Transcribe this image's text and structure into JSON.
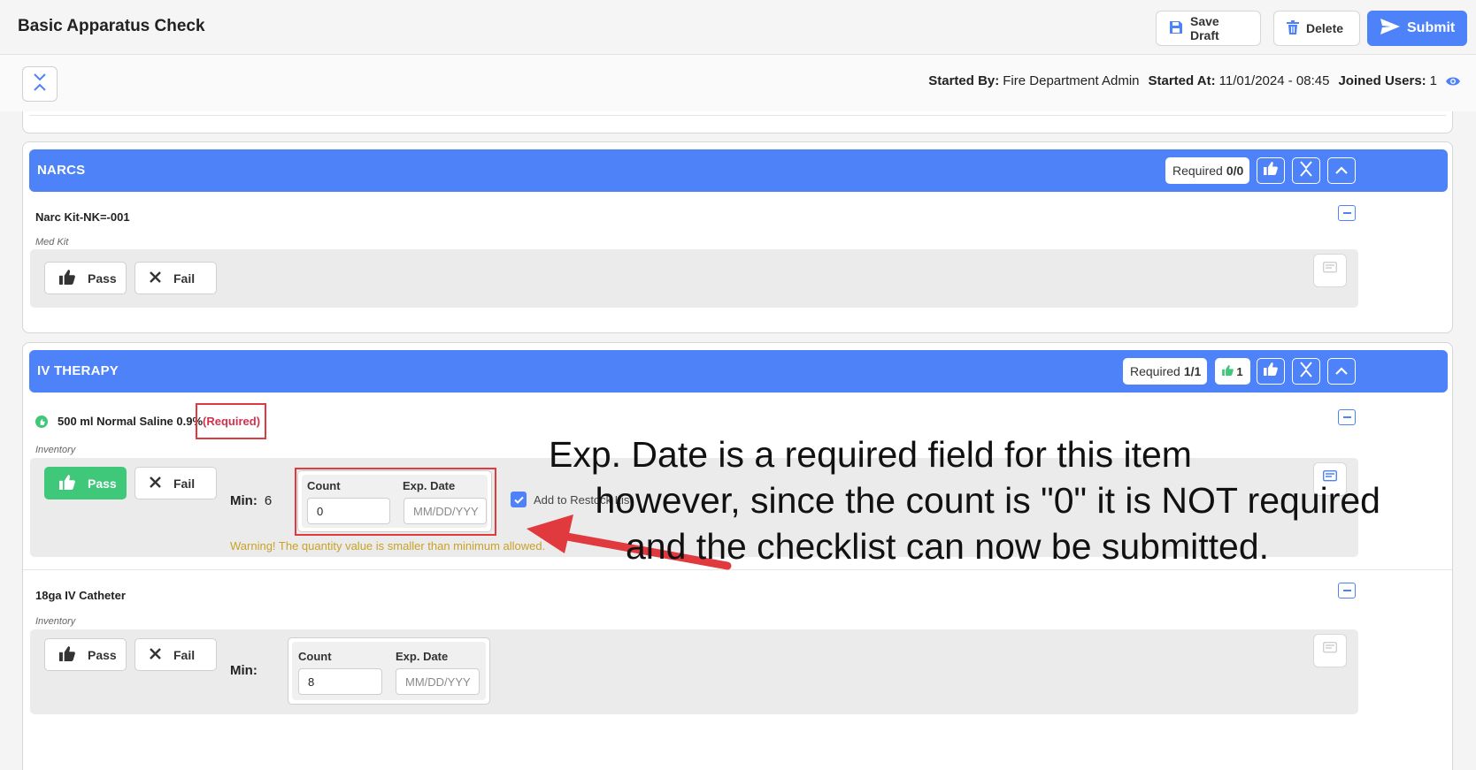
{
  "app": {
    "title": "Basic Apparatus Check"
  },
  "toolbar": {
    "save_draft": "Save Draft",
    "delete": "Delete",
    "submit": "Submit"
  },
  "meta": {
    "started_by_label": "Started By:",
    "started_by": "Fire Department Admin",
    "started_at_label": "Started At:",
    "started_at": "11/01/2024 - 08:45",
    "joined_label": "Joined Users:",
    "joined": "1"
  },
  "sections": [
    {
      "title": "NARCS",
      "required_label": "Required",
      "required_value": "0/0",
      "items": [
        {
          "name": "Narc Kit-NK=-001",
          "type": "Med Kit",
          "pass": "Pass",
          "fail": "Fail"
        }
      ]
    },
    {
      "title": "IV THERAPY",
      "required_label": "Required",
      "required_value": "1/1",
      "pass_count": "1",
      "items": [
        {
          "name": "500 ml Normal Saline 0.9%",
          "required_tag": "(Required)",
          "type": "Inventory",
          "pass": "Pass",
          "fail": "Fail",
          "min_label": "Min:",
          "min_value": "6",
          "count_label": "Count",
          "count_value": "0",
          "exp_label": "Exp. Date",
          "exp_placeholder": "MM/DD/YYY",
          "restock_label": "Add to Restock List",
          "warning": "Warning! The quantity value is smaller than minimum allowed."
        },
        {
          "name": "18ga IV Catheter",
          "type": "Inventory",
          "pass": "Pass",
          "fail": "Fail",
          "min_label": "Min:",
          "count_label": "Count",
          "count_value": "8",
          "exp_label": "Exp. Date",
          "exp_placeholder": "MM/DD/YYY"
        }
      ]
    }
  ],
  "annotation": {
    "line1": "Exp. Date is a required field for this item",
    "line2": "however, since the count is \"0\" it is NOT required",
    "line3": "and the checklist can now be submitted."
  },
  "colors": {
    "primary": "#4e82f8",
    "pass": "#3fc77a",
    "warning": "#c9a227",
    "required": "#d0324a",
    "highlight": "#e0393e"
  }
}
